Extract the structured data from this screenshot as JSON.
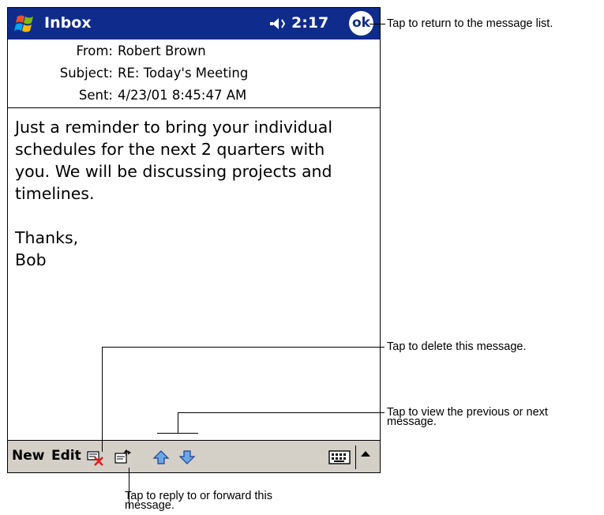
{
  "titlebar": {
    "title": "Inbox",
    "time": "2:17",
    "ok_label": "ok"
  },
  "message": {
    "from_label": "From:",
    "from": "Robert Brown",
    "subject_label": "Subject:",
    "subject": "RE: Today's Meeting",
    "sent_label": "Sent:",
    "sent": "4/23/01 8:45:47 AM",
    "body_lines": [
      "Just a reminder to bring your individual",
      "schedules for the next 2 quarters with",
      "you. We will be discussing projects and",
      "timelines."
    ],
    "closing": [
      "Thanks,",
      "Bob"
    ]
  },
  "toolbar": {
    "new_label": "New",
    "edit_label": "Edit"
  },
  "callouts": {
    "ok": "Tap to return to the message list.",
    "delete": "Tap to delete this message.",
    "navigate_line1": "Tap to view the previous or next",
    "navigate_line2": "message.",
    "reply_line1": "Tap to reply to or forward this",
    "reply_line2": "message."
  },
  "colors": {
    "titlebar": "#0f2c8c",
    "toolbar": "#d4d0c8",
    "delete_x": "#e0201e"
  },
  "icons": [
    "windows-start-icon",
    "speaker-icon",
    "ok-button",
    "delete-icon",
    "reply-forward-icon",
    "previous-arrow-icon",
    "next-arrow-icon",
    "keyboard-icon",
    "sip-arrow-icon"
  ]
}
